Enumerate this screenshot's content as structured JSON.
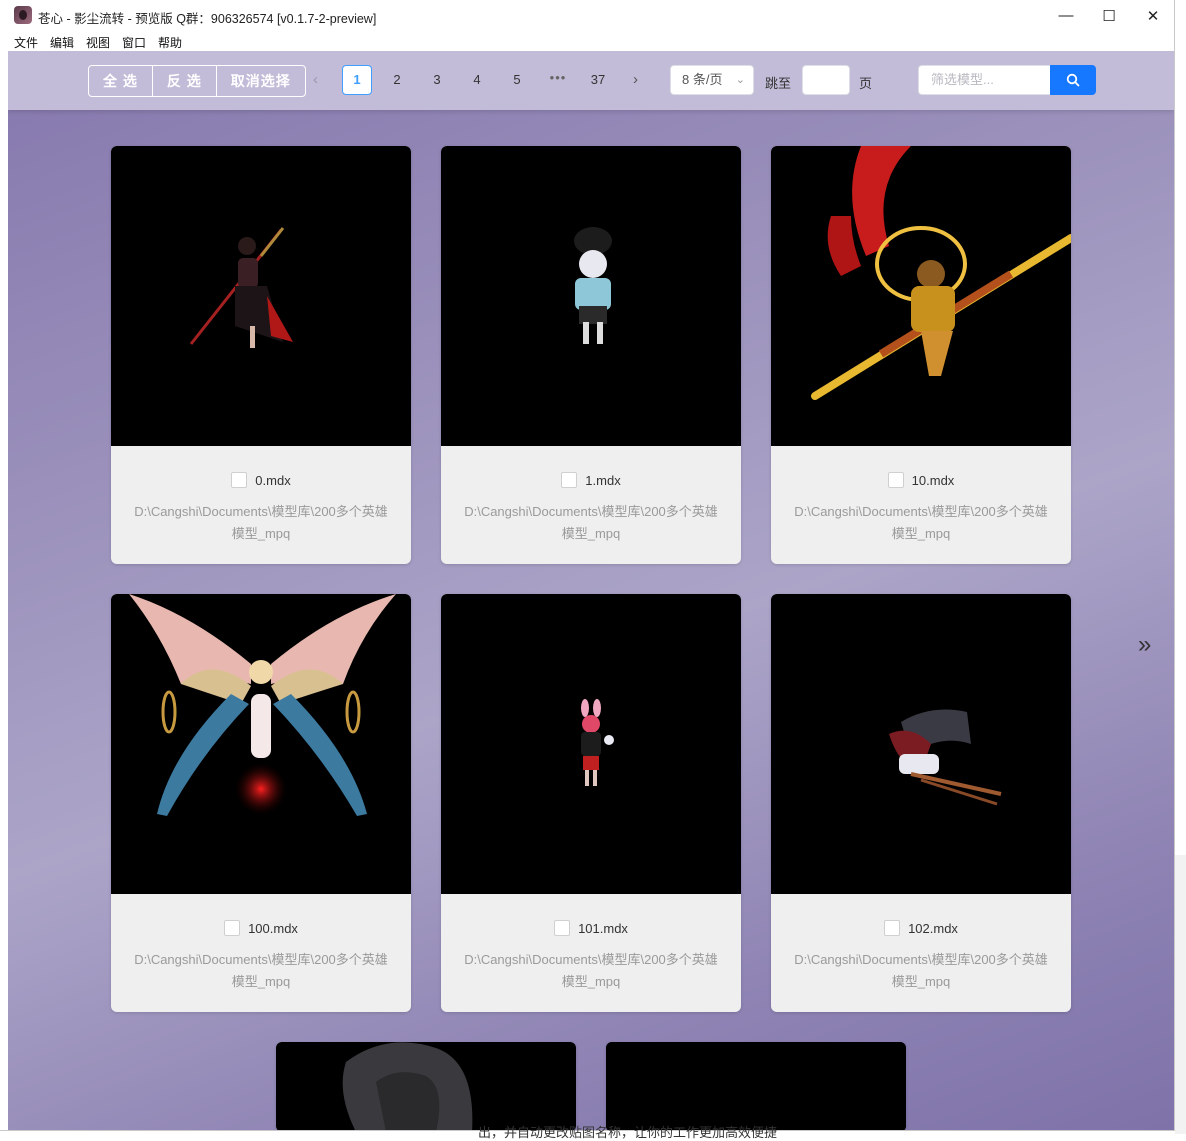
{
  "window": {
    "title": "苍心 - 影尘流转 - 预览版 Q群：906326574 [v0.1.7-2-preview]",
    "controls": {
      "minimize": "—",
      "maximize": "☐",
      "close": "✕"
    }
  },
  "menu": [
    {
      "label": "文件"
    },
    {
      "label": "编辑"
    },
    {
      "label": "视图"
    },
    {
      "label": "窗口"
    },
    {
      "label": "帮助"
    }
  ],
  "toolbar": {
    "select_all": "全 选",
    "invert": "反 选",
    "deselect": "取消选择",
    "prev_icon": "‹",
    "next_icon": "›",
    "pages": [
      "1",
      "2",
      "3",
      "4",
      "5",
      "•••",
      "37"
    ],
    "current_page": "1",
    "page_size": "8 条/页",
    "page_size_chevron": "⌄",
    "jump_prefix": "跳至",
    "jump_suffix": "页",
    "jump_value": "",
    "search_placeholder": "筛选模型...",
    "search_icon": "search-icon"
  },
  "cards": [
    {
      "name": "0.mdx",
      "path": "D:\\Cangshi\\Documents\\模型库\\200多个英雄模型_mpq",
      "checked": false
    },
    {
      "name": "1.mdx",
      "path": "D:\\Cangshi\\Documents\\模型库\\200多个英雄模型_mpq",
      "checked": false
    },
    {
      "name": "10.mdx",
      "path": "D:\\Cangshi\\Documents\\模型库\\200多个英雄模型_mpq",
      "checked": false
    },
    {
      "name": "100.mdx",
      "path": "D:\\Cangshi\\Documents\\模型库\\200多个英雄模型_mpq",
      "checked": false
    },
    {
      "name": "101.mdx",
      "path": "D:\\Cangshi\\Documents\\模型库\\200多个英雄模型_mpq",
      "checked": false
    },
    {
      "name": "102.mdx",
      "path": "D:\\Cangshi\\Documents\\模型库\\200多个英雄模型_mpq",
      "checked": false
    }
  ],
  "side_nav": {
    "next_icon": "»"
  },
  "background_text": "出，并自动更改贴图名称，让你的工作更加高效便捷",
  "colors": {
    "accent": "#1677ff",
    "toolbar_bg": "#c2bcd8",
    "content_bg": "#9a90bb",
    "card_bg": "#efefef"
  }
}
